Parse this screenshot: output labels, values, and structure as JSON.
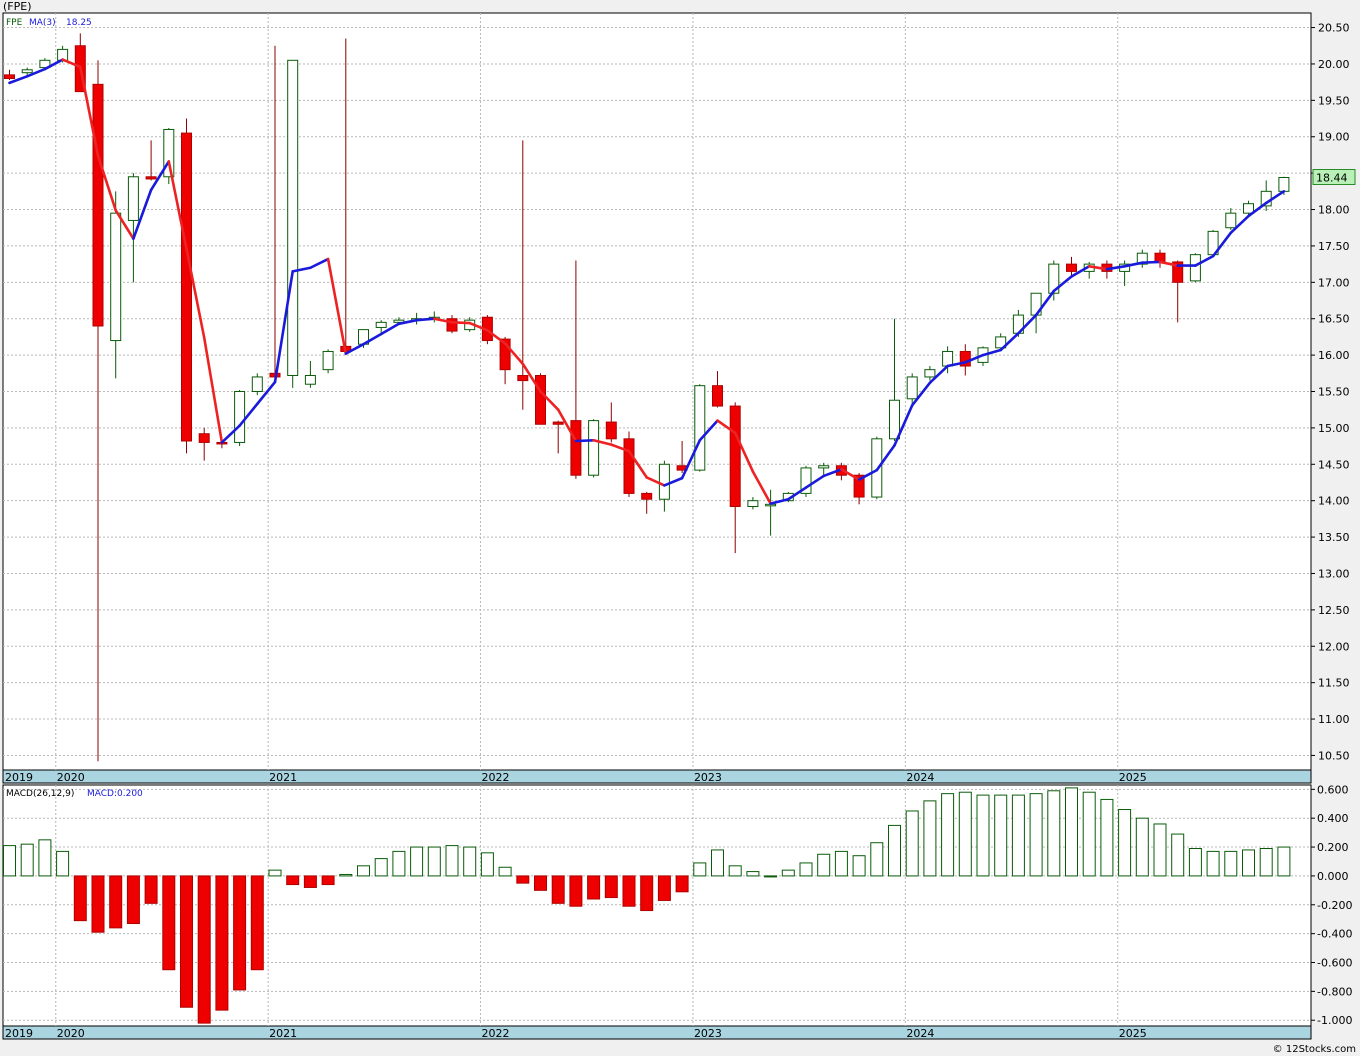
{
  "title": "(FPE)",
  "credit": "© 12Stocks.com",
  "colors": {
    "up": "#0a5c0a",
    "down": "#ee0000",
    "ma_up": "#1a1adc",
    "ma_down": "#ee2222",
    "axis_band": "#a9d4e0",
    "grid": "#b8b8b8",
    "last_bg": "#b8f0b8"
  },
  "chart_data": [
    {
      "type": "candlestick",
      "legend": {
        "symbol": "FPE",
        "ma_label": "MA(3)",
        "ma_value": "18.25"
      },
      "last_price": "18.44",
      "ylim": [
        10.3,
        20.7
      ],
      "y_ticks": [
        "20.50",
        "20.00",
        "19.50",
        "19.00",
        "18.50",
        "18.00",
        "17.50",
        "17.00",
        "16.50",
        "16.00",
        "15.50",
        "15.00",
        "14.50",
        "14.00",
        "13.50",
        "13.00",
        "12.50",
        "12.00",
        "11.50",
        "11.00",
        "10.50"
      ],
      "x_labels": [
        {
          "label": "2019",
          "index": -0.6
        },
        {
          "label": "2020",
          "index": 3
        },
        {
          "label": "2021",
          "index": 15
        },
        {
          "label": "2022",
          "index": 27
        },
        {
          "label": "2023",
          "index": 39
        },
        {
          "label": "2024",
          "index": 51
        },
        {
          "label": "2025",
          "index": 63
        }
      ],
      "candles": [
        [
          19.85,
          19.92,
          19.78,
          19.8
        ],
        [
          19.88,
          19.95,
          19.85,
          19.92
        ],
        [
          19.95,
          20.08,
          19.92,
          20.05
        ],
        [
          20.05,
          20.25,
          20.02,
          20.2
        ],
        [
          20.25,
          20.42,
          19.62,
          19.62
        ],
        [
          19.72,
          20.05,
          10.42,
          16.4
        ],
        [
          16.2,
          18.25,
          15.68,
          17.95
        ],
        [
          17.85,
          18.5,
          17.0,
          18.45
        ],
        [
          18.45,
          18.95,
          18.4,
          18.42
        ],
        [
          18.45,
          19.12,
          18.35,
          19.1
        ],
        [
          19.05,
          19.25,
          14.65,
          14.82
        ],
        [
          14.92,
          15.0,
          14.55,
          14.8
        ],
        [
          14.8,
          14.82,
          14.72,
          14.78
        ],
        [
          14.8,
          15.52,
          14.75,
          15.5
        ],
        [
          15.5,
          15.75,
          15.45,
          15.7
        ],
        [
          15.75,
          20.25,
          15.62,
          15.7
        ],
        [
          15.72,
          20.05,
          15.55,
          20.05
        ],
        [
          15.6,
          15.92,
          15.55,
          15.72
        ],
        [
          15.8,
          16.08,
          15.75,
          16.05
        ],
        [
          16.12,
          20.35,
          16.0,
          16.05
        ],
        [
          16.15,
          16.35,
          16.1,
          16.35
        ],
        [
          16.38,
          16.48,
          16.3,
          16.45
        ],
        [
          16.45,
          16.52,
          16.42,
          16.48
        ],
        [
          16.48,
          16.58,
          16.42,
          16.5
        ],
        [
          16.52,
          16.6,
          16.45,
          16.52
        ],
        [
          16.5,
          16.55,
          16.3,
          16.33
        ],
        [
          16.35,
          16.52,
          16.32,
          16.48
        ],
        [
          16.52,
          16.55,
          16.15,
          16.2
        ],
        [
          16.22,
          16.25,
          15.6,
          15.8
        ],
        [
          15.72,
          18.95,
          15.25,
          15.65
        ],
        [
          15.72,
          15.75,
          15.05,
          15.05
        ],
        [
          15.08,
          15.1,
          14.65,
          15.05
        ],
        [
          15.1,
          17.3,
          14.3,
          14.35
        ],
        [
          14.35,
          15.12,
          14.32,
          15.1
        ],
        [
          15.08,
          15.35,
          14.8,
          14.85
        ],
        [
          14.85,
          14.95,
          14.05,
          14.1
        ],
        [
          14.1,
          14.12,
          13.82,
          14.02
        ],
        [
          14.02,
          14.55,
          13.85,
          14.5
        ],
        [
          14.48,
          14.82,
          14.38,
          14.42
        ],
        [
          14.42,
          15.6,
          14.4,
          15.58
        ],
        [
          15.58,
          15.78,
          15.28,
          15.3
        ],
        [
          15.3,
          15.35,
          13.28,
          13.92
        ],
        [
          13.92,
          14.05,
          13.88,
          14.0
        ],
        [
          13.95,
          14.15,
          13.52,
          13.95
        ],
        [
          14.0,
          14.12,
          13.98,
          14.1
        ],
        [
          14.1,
          14.48,
          14.05,
          14.45
        ],
        [
          14.45,
          14.52,
          14.32,
          14.48
        ],
        [
          14.48,
          14.52,
          14.28,
          14.35
        ],
        [
          14.35,
          14.38,
          13.95,
          14.05
        ],
        [
          14.05,
          14.88,
          14.02,
          14.85
        ],
        [
          14.85,
          16.5,
          14.82,
          15.38
        ],
        [
          15.4,
          15.75,
          15.3,
          15.7
        ],
        [
          15.7,
          15.85,
          15.65,
          15.8
        ],
        [
          15.85,
          16.12,
          15.75,
          16.05
        ],
        [
          16.05,
          16.15,
          15.72,
          15.85
        ],
        [
          15.9,
          16.12,
          15.85,
          16.1
        ],
        [
          16.1,
          16.3,
          16.05,
          16.25
        ],
        [
          16.3,
          16.62,
          16.25,
          16.55
        ],
        [
          16.55,
          16.85,
          16.3,
          16.85
        ],
        [
          16.85,
          17.3,
          16.75,
          17.25
        ],
        [
          17.25,
          17.35,
          17.1,
          17.15
        ],
        [
          17.15,
          17.28,
          17.05,
          17.25
        ],
        [
          17.25,
          17.3,
          17.05,
          17.15
        ],
        [
          17.15,
          17.3,
          16.95,
          17.25
        ],
        [
          17.25,
          17.45,
          17.2,
          17.4
        ],
        [
          17.4,
          17.45,
          17.2,
          17.28
        ],
        [
          17.28,
          17.3,
          16.45,
          17.0
        ],
        [
          17.02,
          17.4,
          17.0,
          17.38
        ],
        [
          17.38,
          17.72,
          17.35,
          17.7
        ],
        [
          17.75,
          18.02,
          17.72,
          17.95
        ],
        [
          17.95,
          18.12,
          17.92,
          18.08
        ],
        [
          18.05,
          18.4,
          17.98,
          18.25
        ],
        [
          18.25,
          18.45,
          18.2,
          18.44
        ]
      ],
      "ma": [
        19.74,
        19.83,
        19.93,
        20.06,
        19.96,
        18.74,
        17.99,
        17.6,
        18.27,
        18.66,
        17.46,
        16.24,
        14.8,
        15.03,
        15.33,
        15.63,
        17.15,
        17.2,
        17.32,
        16.02,
        16.15,
        16.29,
        16.43,
        16.48,
        16.5,
        16.45,
        16.44,
        16.34,
        16.16,
        15.88,
        15.5,
        15.25,
        14.82,
        14.83,
        14.77,
        14.68,
        14.32,
        14.21,
        14.31,
        14.83,
        15.1,
        14.93,
        14.4,
        13.96,
        14.02,
        14.18,
        14.34,
        14.43,
        14.29,
        14.42,
        14.76,
        15.31,
        15.62,
        15.85,
        15.9,
        16.0,
        16.07,
        16.3,
        16.55,
        16.88,
        17.08,
        17.22,
        17.18,
        17.22,
        17.27,
        17.28,
        17.23,
        17.23,
        17.36,
        17.68,
        17.91,
        18.09,
        18.25
      ],
      "xlabel": "",
      "ylabel": ""
    },
    {
      "type": "bar",
      "legend": {
        "name": "MACD(26,12,9)",
        "value_label": "MACD:0.200"
      },
      "ylim": [
        -1.04,
        0.63
      ],
      "y_ticks": [
        "0.600",
        "0.400",
        "0.200",
        "0.000",
        "-0.200",
        "-0.400",
        "-0.600",
        "-0.800",
        "-1.000"
      ],
      "values": [
        0.21,
        0.22,
        0.25,
        0.17,
        -0.31,
        -0.39,
        -0.36,
        -0.33,
        -0.19,
        -0.65,
        -0.91,
        -1.02,
        -0.93,
        -0.79,
        -0.65,
        0.04,
        -0.06,
        -0.08,
        -0.06,
        0.01,
        0.07,
        0.12,
        0.17,
        0.2,
        0.2,
        0.21,
        0.2,
        0.16,
        0.06,
        -0.05,
        -0.1,
        -0.19,
        -0.21,
        -0.16,
        -0.15,
        -0.21,
        -0.24,
        -0.17,
        -0.11,
        0.09,
        0.18,
        0.07,
        0.03,
        0.0,
        0.04,
        0.09,
        0.15,
        0.17,
        0.14,
        0.23,
        0.35,
        0.45,
        0.52,
        0.57,
        0.58,
        0.56,
        0.56,
        0.56,
        0.57,
        0.59,
        0.61,
        0.58,
        0.53,
        0.46,
        0.4,
        0.36,
        0.29,
        0.19,
        0.17,
        0.17,
        0.18,
        0.19,
        0.2
      ],
      "xlabel": "",
      "ylabel": ""
    }
  ]
}
